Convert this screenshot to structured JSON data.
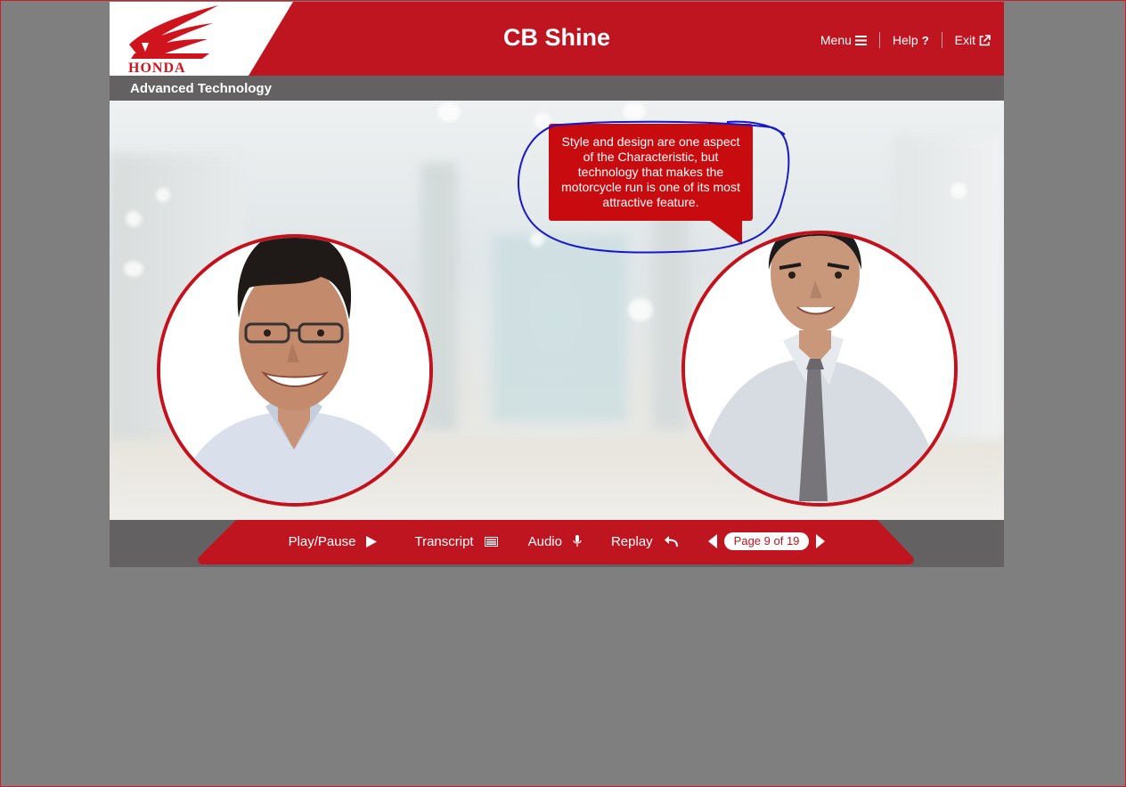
{
  "app": {
    "brand": "HONDA",
    "title": "CB Shine",
    "section": "Advanced Technology"
  },
  "top_nav": {
    "menu": "Menu",
    "help": "Help",
    "exit": "Exit"
  },
  "speech_bubble": {
    "text": "Style and design are one aspect of the Characteristic, but technology that makes the motorcycle run is one of its most attractive feature."
  },
  "controls": {
    "play_pause": "Play/Pause",
    "transcript": "Transcript",
    "audio": "Audio",
    "replay": "Replay",
    "page_indicator": "Page 9 of 19"
  },
  "colors": {
    "brand_red": "#bf1520",
    "bubble_red": "#c80b0f",
    "bar_gray": "#636161",
    "page_bg": "#7f7f7f",
    "annotation_blue": "#1818c8"
  }
}
